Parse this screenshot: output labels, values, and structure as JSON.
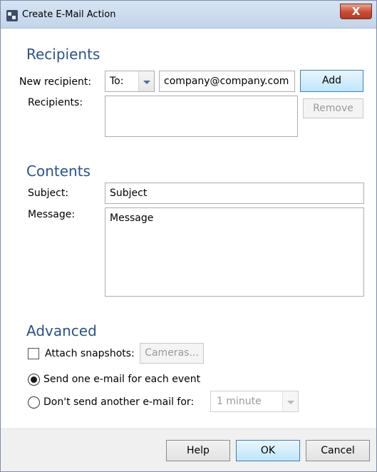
{
  "window": {
    "title": "Create E-Mail Action",
    "close_glyph": "X"
  },
  "recipients": {
    "heading": "Recipients",
    "new_recipient_label": "New recipient:",
    "type_value": "To:",
    "email_value": "company@company.com",
    "add_button": "Add",
    "list_label": "Recipients:",
    "remove_button": "Remove"
  },
  "contents": {
    "heading": "Contents",
    "subject_label": "Subject:",
    "subject_value": "Subject",
    "message_label": "Message:",
    "message_value": "Message"
  },
  "advanced": {
    "heading": "Advanced",
    "attach_snapshots_label": "Attach snapshots:",
    "attach_snapshots_checked": false,
    "cameras_button": "Cameras...",
    "send_each_label": "Send one e-mail for each event",
    "send_each_selected": true,
    "dont_send_label": "Don't send another e-mail for:",
    "dont_send_selected": false,
    "interval_value": "1 minute"
  },
  "footer": {
    "help_button": "Help",
    "ok_button": "OK",
    "cancel_button": "Cancel"
  },
  "icons": {
    "app": "app-icon",
    "close": "close-icon",
    "dropdown": "chevron-down-icon"
  },
  "colors": {
    "section_heading": "#2a5289",
    "titlebar": "#c3d5ea",
    "close_button": "#c94a33",
    "footer": "#f0f0f0"
  }
}
